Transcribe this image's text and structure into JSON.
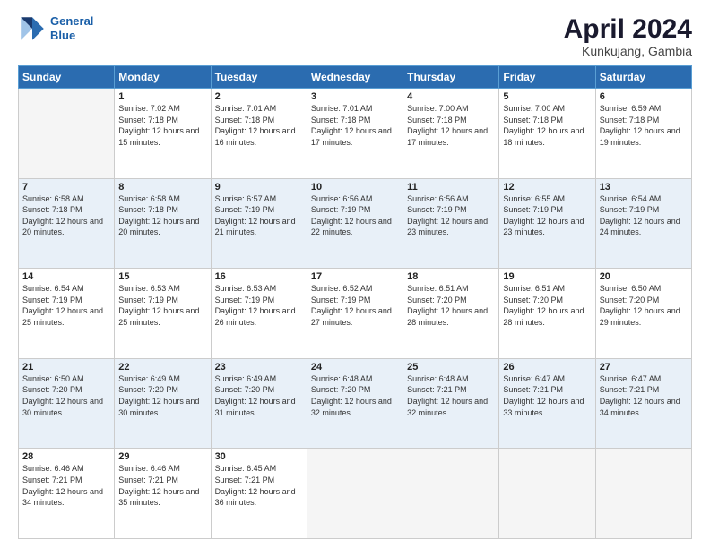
{
  "header": {
    "logo": {
      "line1": "General",
      "line2": "Blue"
    },
    "title": "April 2024",
    "location": "Kunkujang, Gambia"
  },
  "weekdays": [
    "Sunday",
    "Monday",
    "Tuesday",
    "Wednesday",
    "Thursday",
    "Friday",
    "Saturday"
  ],
  "weeks": [
    [
      {
        "day": "",
        "sunrise": "",
        "sunset": "",
        "daylight": "",
        "empty": true
      },
      {
        "day": "1",
        "sunrise": "Sunrise: 7:02 AM",
        "sunset": "Sunset: 7:18 PM",
        "daylight": "Daylight: 12 hours and 15 minutes."
      },
      {
        "day": "2",
        "sunrise": "Sunrise: 7:01 AM",
        "sunset": "Sunset: 7:18 PM",
        "daylight": "Daylight: 12 hours and 16 minutes."
      },
      {
        "day": "3",
        "sunrise": "Sunrise: 7:01 AM",
        "sunset": "Sunset: 7:18 PM",
        "daylight": "Daylight: 12 hours and 17 minutes."
      },
      {
        "day": "4",
        "sunrise": "Sunrise: 7:00 AM",
        "sunset": "Sunset: 7:18 PM",
        "daylight": "Daylight: 12 hours and 17 minutes."
      },
      {
        "day": "5",
        "sunrise": "Sunrise: 7:00 AM",
        "sunset": "Sunset: 7:18 PM",
        "daylight": "Daylight: 12 hours and 18 minutes."
      },
      {
        "day": "6",
        "sunrise": "Sunrise: 6:59 AM",
        "sunset": "Sunset: 7:18 PM",
        "daylight": "Daylight: 12 hours and 19 minutes."
      }
    ],
    [
      {
        "day": "7",
        "sunrise": "Sunrise: 6:58 AM",
        "sunset": "Sunset: 7:18 PM",
        "daylight": "Daylight: 12 hours and 20 minutes."
      },
      {
        "day": "8",
        "sunrise": "Sunrise: 6:58 AM",
        "sunset": "Sunset: 7:18 PM",
        "daylight": "Daylight: 12 hours and 20 minutes."
      },
      {
        "day": "9",
        "sunrise": "Sunrise: 6:57 AM",
        "sunset": "Sunset: 7:19 PM",
        "daylight": "Daylight: 12 hours and 21 minutes."
      },
      {
        "day": "10",
        "sunrise": "Sunrise: 6:56 AM",
        "sunset": "Sunset: 7:19 PM",
        "daylight": "Daylight: 12 hours and 22 minutes."
      },
      {
        "day": "11",
        "sunrise": "Sunrise: 6:56 AM",
        "sunset": "Sunset: 7:19 PM",
        "daylight": "Daylight: 12 hours and 23 minutes."
      },
      {
        "day": "12",
        "sunrise": "Sunrise: 6:55 AM",
        "sunset": "Sunset: 7:19 PM",
        "daylight": "Daylight: 12 hours and 23 minutes."
      },
      {
        "day": "13",
        "sunrise": "Sunrise: 6:54 AM",
        "sunset": "Sunset: 7:19 PM",
        "daylight": "Daylight: 12 hours and 24 minutes."
      }
    ],
    [
      {
        "day": "14",
        "sunrise": "Sunrise: 6:54 AM",
        "sunset": "Sunset: 7:19 PM",
        "daylight": "Daylight: 12 hours and 25 minutes."
      },
      {
        "day": "15",
        "sunrise": "Sunrise: 6:53 AM",
        "sunset": "Sunset: 7:19 PM",
        "daylight": "Daylight: 12 hours and 25 minutes."
      },
      {
        "day": "16",
        "sunrise": "Sunrise: 6:53 AM",
        "sunset": "Sunset: 7:19 PM",
        "daylight": "Daylight: 12 hours and 26 minutes."
      },
      {
        "day": "17",
        "sunrise": "Sunrise: 6:52 AM",
        "sunset": "Sunset: 7:19 PM",
        "daylight": "Daylight: 12 hours and 27 minutes."
      },
      {
        "day": "18",
        "sunrise": "Sunrise: 6:51 AM",
        "sunset": "Sunset: 7:20 PM",
        "daylight": "Daylight: 12 hours and 28 minutes."
      },
      {
        "day": "19",
        "sunrise": "Sunrise: 6:51 AM",
        "sunset": "Sunset: 7:20 PM",
        "daylight": "Daylight: 12 hours and 28 minutes."
      },
      {
        "day": "20",
        "sunrise": "Sunrise: 6:50 AM",
        "sunset": "Sunset: 7:20 PM",
        "daylight": "Daylight: 12 hours and 29 minutes."
      }
    ],
    [
      {
        "day": "21",
        "sunrise": "Sunrise: 6:50 AM",
        "sunset": "Sunset: 7:20 PM",
        "daylight": "Daylight: 12 hours and 30 minutes."
      },
      {
        "day": "22",
        "sunrise": "Sunrise: 6:49 AM",
        "sunset": "Sunset: 7:20 PM",
        "daylight": "Daylight: 12 hours and 30 minutes."
      },
      {
        "day": "23",
        "sunrise": "Sunrise: 6:49 AM",
        "sunset": "Sunset: 7:20 PM",
        "daylight": "Daylight: 12 hours and 31 minutes."
      },
      {
        "day": "24",
        "sunrise": "Sunrise: 6:48 AM",
        "sunset": "Sunset: 7:20 PM",
        "daylight": "Daylight: 12 hours and 32 minutes."
      },
      {
        "day": "25",
        "sunrise": "Sunrise: 6:48 AM",
        "sunset": "Sunset: 7:21 PM",
        "daylight": "Daylight: 12 hours and 32 minutes."
      },
      {
        "day": "26",
        "sunrise": "Sunrise: 6:47 AM",
        "sunset": "Sunset: 7:21 PM",
        "daylight": "Daylight: 12 hours and 33 minutes."
      },
      {
        "day": "27",
        "sunrise": "Sunrise: 6:47 AM",
        "sunset": "Sunset: 7:21 PM",
        "daylight": "Daylight: 12 hours and 34 minutes."
      }
    ],
    [
      {
        "day": "28",
        "sunrise": "Sunrise: 6:46 AM",
        "sunset": "Sunset: 7:21 PM",
        "daylight": "Daylight: 12 hours and 34 minutes."
      },
      {
        "day": "29",
        "sunrise": "Sunrise: 6:46 AM",
        "sunset": "Sunset: 7:21 PM",
        "daylight": "Daylight: 12 hours and 35 minutes."
      },
      {
        "day": "30",
        "sunrise": "Sunrise: 6:45 AM",
        "sunset": "Sunset: 7:21 PM",
        "daylight": "Daylight: 12 hours and 36 minutes."
      },
      {
        "day": "",
        "sunrise": "",
        "sunset": "",
        "daylight": "",
        "empty": true
      },
      {
        "day": "",
        "sunrise": "",
        "sunset": "",
        "daylight": "",
        "empty": true
      },
      {
        "day": "",
        "sunrise": "",
        "sunset": "",
        "daylight": "",
        "empty": true
      },
      {
        "day": "",
        "sunrise": "",
        "sunset": "",
        "daylight": "",
        "empty": true
      }
    ]
  ]
}
